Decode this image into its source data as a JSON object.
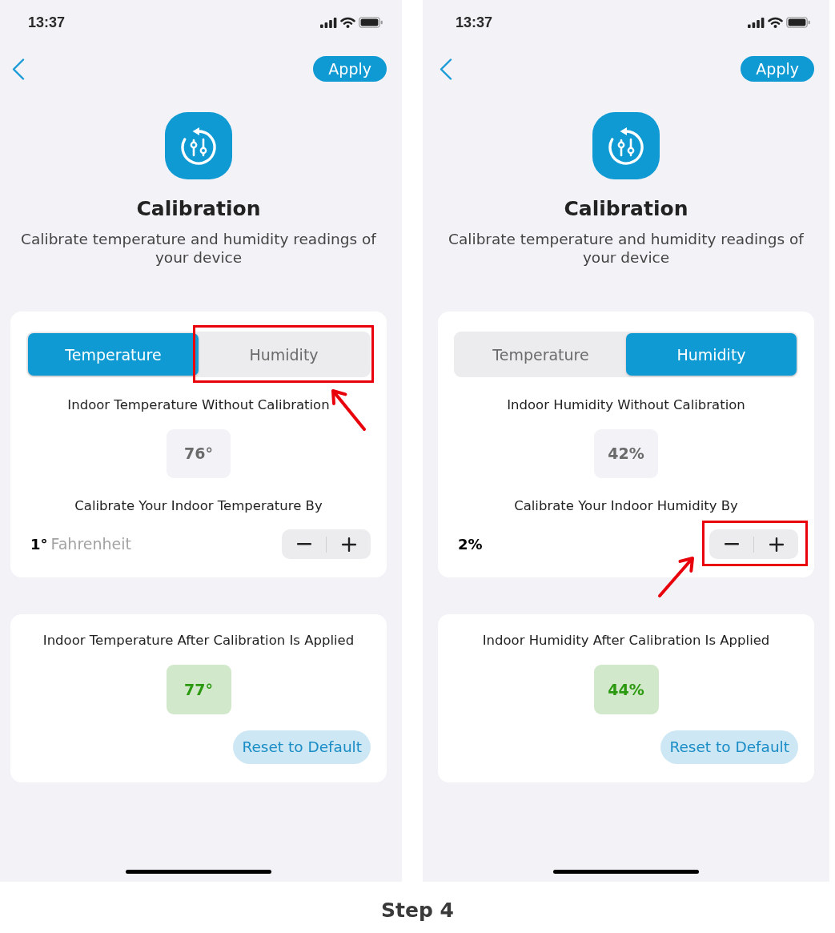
{
  "screens": [
    {
      "status_bar": {
        "time": "13:37"
      },
      "nav": {
        "apply_button": "Apply"
      },
      "header": {
        "title": "Calibration",
        "subtitle": "Calibrate temperature and humidity readings of your device"
      },
      "tabs": [
        {
          "label": "Temperature",
          "selected": true,
          "highlighted": false
        },
        {
          "label": "Humidity",
          "selected": false,
          "highlighted": true
        }
      ],
      "reading": {
        "label": "Indoor Temperature Without Calibration",
        "value": "76°"
      },
      "adjustment": {
        "label": "Calibrate Your Indoor Temperature By",
        "value": "1°",
        "unit": "Fahrenheit",
        "stepper_highlighted": false
      },
      "result": {
        "label": "Indoor Temperature After Calibration Is Applied",
        "value": "77°",
        "reset_button": "Reset to Default"
      }
    },
    {
      "status_bar": {
        "time": "13:37"
      },
      "nav": {
        "apply_button": "Apply"
      },
      "header": {
        "title": "Calibration",
        "subtitle": "Calibrate temperature and humidity readings of your device"
      },
      "tabs": [
        {
          "label": "Temperature",
          "selected": false,
          "highlighted": false
        },
        {
          "label": "Humidity",
          "selected": true,
          "highlighted": false
        }
      ],
      "reading": {
        "label": "Indoor Humidity Without Calibration",
        "value": "42%"
      },
      "adjustment": {
        "label": "Calibrate Your Indoor Humidity By",
        "value": "2%",
        "stepper_highlighted": true
      },
      "result": {
        "label": "Indoor Humidity After Calibration Is Applied",
        "value": "44%",
        "reset_button": "Reset to Default"
      }
    }
  ],
  "caption": "Step 4"
}
